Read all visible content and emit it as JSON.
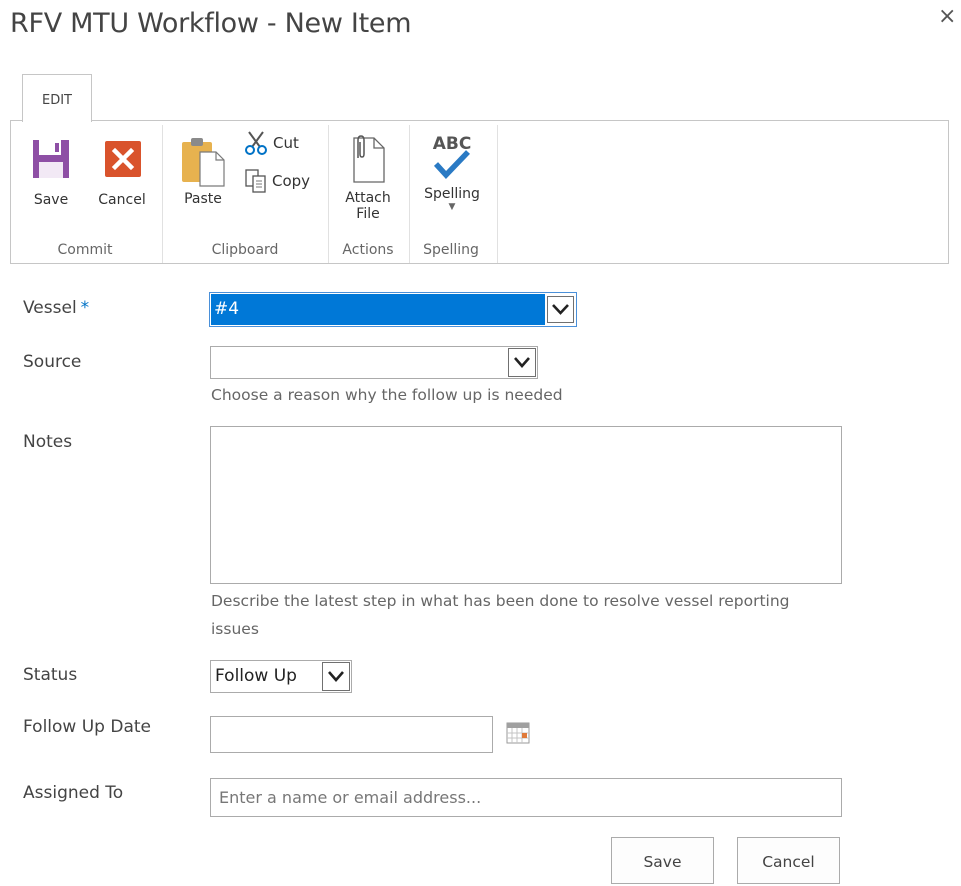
{
  "dialog": {
    "title": "RFV MTU Workflow - New Item",
    "close": "×"
  },
  "ribbon": {
    "tab": "EDIT",
    "commit": {
      "save": "Save",
      "cancel": "Cancel",
      "group": "Commit"
    },
    "clipboard": {
      "paste": "Paste",
      "cut": "Cut",
      "copy": "Copy",
      "group": "Clipboard"
    },
    "actions": {
      "attach_line1": "Attach",
      "attach_line2": "File",
      "group": "Actions"
    },
    "spelling": {
      "abc": "ABC",
      "label": "Spelling",
      "group": "Spelling"
    }
  },
  "form": {
    "vessel": {
      "label": "Vessel",
      "required": "*",
      "value": "#4"
    },
    "source": {
      "label": "Source",
      "value": "",
      "hint": "Choose a reason why the follow up is needed"
    },
    "notes": {
      "label": "Notes",
      "value": "",
      "hint_line1": "Describe the latest step in what has been done to resolve vessel reporting",
      "hint_line2": "issues"
    },
    "status": {
      "label": "Status",
      "value": "Follow Up"
    },
    "follow_up_date": {
      "label": "Follow Up Date",
      "value": ""
    },
    "assigned_to": {
      "label": "Assigned To",
      "placeholder": "Enter a name or email address..."
    }
  },
  "buttons": {
    "save": "Save",
    "cancel": "Cancel"
  },
  "colors": {
    "accent": "#0072c6",
    "selected": "#0078d7",
    "save_icon": "#8e4fa5",
    "cancel_icon": "#d9532c"
  }
}
